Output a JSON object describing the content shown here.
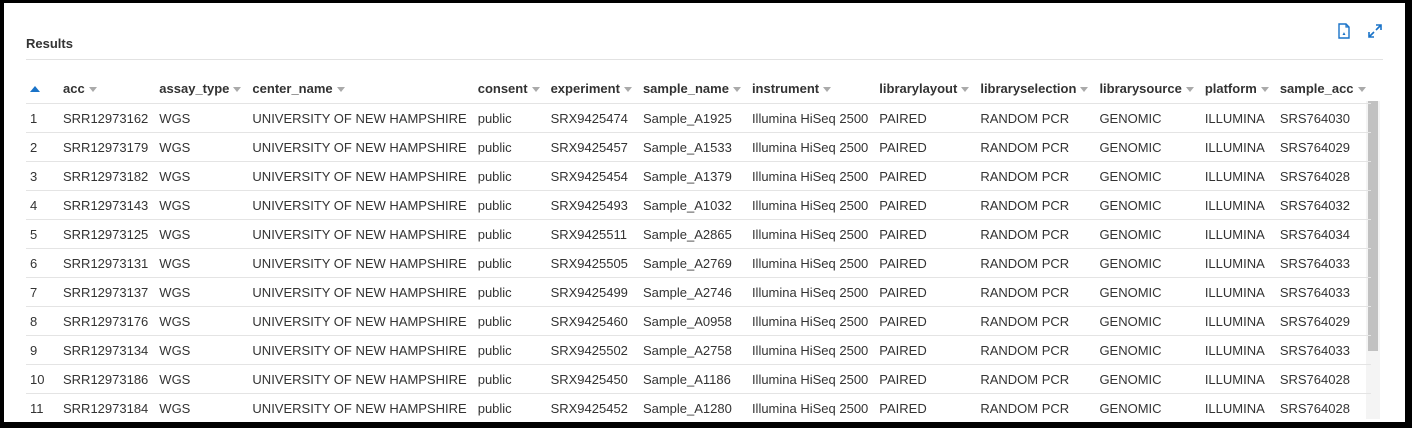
{
  "panel": {
    "title": "Results",
    "pdf_icon": "pdf-export-icon",
    "expand_icon": "expand-icon",
    "accent_color": "#1a73c8"
  },
  "table": {
    "columns": [
      "acc",
      "assay_type",
      "center_name",
      "consent",
      "experiment",
      "sample_name",
      "instrument",
      "librarylayout",
      "libraryselection",
      "librarysource",
      "platform",
      "sample_acc"
    ],
    "sort_indicator": "ascending",
    "rows": [
      {
        "n": "1",
        "cells": [
          "SRR12973162",
          "WGS",
          "UNIVERSITY OF NEW HAMPSHIRE",
          "public",
          "SRX9425474",
          "Sample_A1925",
          "Illumina HiSeq 2500",
          "PAIRED",
          "RANDOM PCR",
          "GENOMIC",
          "ILLUMINA",
          "SRS764030"
        ]
      },
      {
        "n": "2",
        "cells": [
          "SRR12973179",
          "WGS",
          "UNIVERSITY OF NEW HAMPSHIRE",
          "public",
          "SRX9425457",
          "Sample_A1533",
          "Illumina HiSeq 2500",
          "PAIRED",
          "RANDOM PCR",
          "GENOMIC",
          "ILLUMINA",
          "SRS764029"
        ]
      },
      {
        "n": "3",
        "cells": [
          "SRR12973182",
          "WGS",
          "UNIVERSITY OF NEW HAMPSHIRE",
          "public",
          "SRX9425454",
          "Sample_A1379",
          "Illumina HiSeq 2500",
          "PAIRED",
          "RANDOM PCR",
          "GENOMIC",
          "ILLUMINA",
          "SRS764028"
        ]
      },
      {
        "n": "4",
        "cells": [
          "SRR12973143",
          "WGS",
          "UNIVERSITY OF NEW HAMPSHIRE",
          "public",
          "SRX9425493",
          "Sample_A1032",
          "Illumina HiSeq 2500",
          "PAIRED",
          "RANDOM PCR",
          "GENOMIC",
          "ILLUMINA",
          "SRS764032"
        ]
      },
      {
        "n": "5",
        "cells": [
          "SRR12973125",
          "WGS",
          "UNIVERSITY OF NEW HAMPSHIRE",
          "public",
          "SRX9425511",
          "Sample_A2865",
          "Illumina HiSeq 2500",
          "PAIRED",
          "RANDOM PCR",
          "GENOMIC",
          "ILLUMINA",
          "SRS764034"
        ]
      },
      {
        "n": "6",
        "cells": [
          "SRR12973131",
          "WGS",
          "UNIVERSITY OF NEW HAMPSHIRE",
          "public",
          "SRX9425505",
          "Sample_A2769",
          "Illumina HiSeq 2500",
          "PAIRED",
          "RANDOM PCR",
          "GENOMIC",
          "ILLUMINA",
          "SRS764033"
        ]
      },
      {
        "n": "7",
        "cells": [
          "SRR12973137",
          "WGS",
          "UNIVERSITY OF NEW HAMPSHIRE",
          "public",
          "SRX9425499",
          "Sample_A2746",
          "Illumina HiSeq 2500",
          "PAIRED",
          "RANDOM PCR",
          "GENOMIC",
          "ILLUMINA",
          "SRS764033"
        ]
      },
      {
        "n": "8",
        "cells": [
          "SRR12973176",
          "WGS",
          "UNIVERSITY OF NEW HAMPSHIRE",
          "public",
          "SRX9425460",
          "Sample_A0958",
          "Illumina HiSeq 2500",
          "PAIRED",
          "RANDOM PCR",
          "GENOMIC",
          "ILLUMINA",
          "SRS764029"
        ]
      },
      {
        "n": "9",
        "cells": [
          "SRR12973134",
          "WGS",
          "UNIVERSITY OF NEW HAMPSHIRE",
          "public",
          "SRX9425502",
          "Sample_A2758",
          "Illumina HiSeq 2500",
          "PAIRED",
          "RANDOM PCR",
          "GENOMIC",
          "ILLUMINA",
          "SRS764033"
        ]
      },
      {
        "n": "10",
        "cells": [
          "SRR12973186",
          "WGS",
          "UNIVERSITY OF NEW HAMPSHIRE",
          "public",
          "SRX9425450",
          "Sample_A1186",
          "Illumina HiSeq 2500",
          "PAIRED",
          "RANDOM PCR",
          "GENOMIC",
          "ILLUMINA",
          "SRS764028"
        ]
      },
      {
        "n": "11",
        "cells": [
          "SRR12973184",
          "WGS",
          "UNIVERSITY OF NEW HAMPSHIRE",
          "public",
          "SRX9425452",
          "Sample_A1280",
          "Illumina HiSeq 2500",
          "PAIRED",
          "RANDOM PCR",
          "GENOMIC",
          "ILLUMINA",
          "SRS764028"
        ]
      }
    ]
  }
}
